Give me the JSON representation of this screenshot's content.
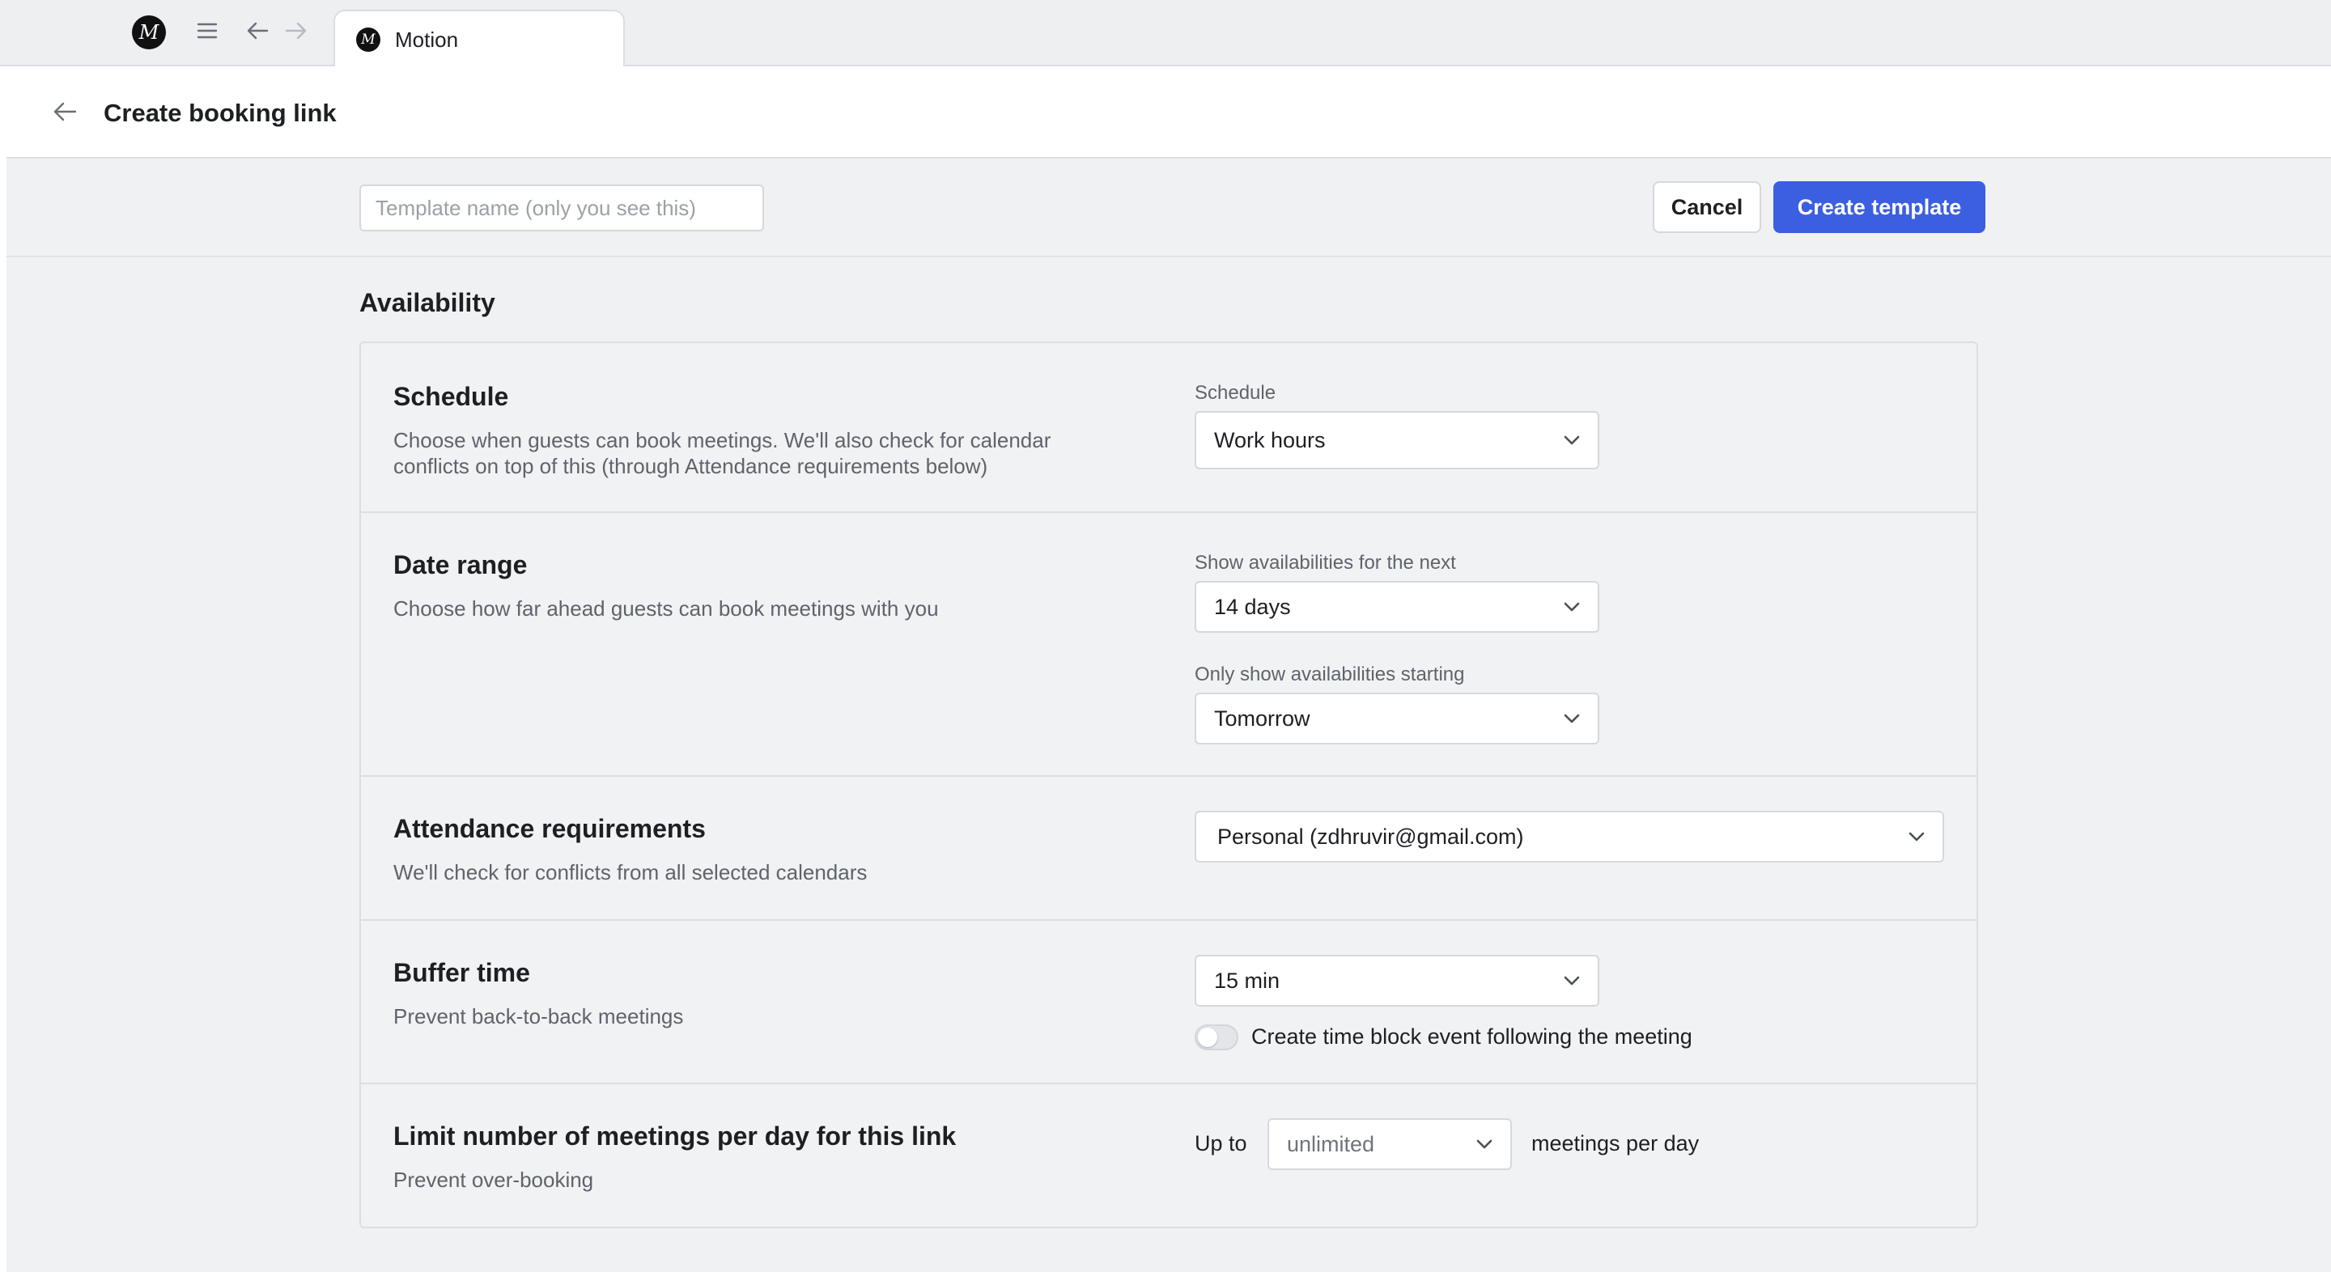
{
  "browser": {
    "logo_letter": "M",
    "tab": {
      "title": "Motion",
      "logo_letter": "M"
    }
  },
  "header": {
    "title": "Create booking link"
  },
  "toolbar": {
    "template_name_value": "",
    "template_name_placeholder": "Template name (only you see this)",
    "cancel_label": "Cancel",
    "create_label": "Create template"
  },
  "availability": {
    "section_title": "Availability",
    "schedule": {
      "title": "Schedule",
      "description": "Choose when guests can book meetings. We'll also check for calendar conflicts on top of this (through Attendance requirements below)",
      "field_label": "Schedule",
      "value": "Work hours"
    },
    "date_range": {
      "title": "Date range",
      "description": "Choose how far ahead guests can book meetings with you",
      "next_label": "Show availabilities for the next",
      "next_value": "14 days",
      "starting_label": "Only show availabilities starting",
      "starting_value": "Tomorrow"
    },
    "attendance": {
      "title": "Attendance requirements",
      "description": "We'll check for conflicts from all selected calendars",
      "value": "Personal (zdhruvir@gmail.com)"
    },
    "buffer": {
      "title": "Buffer time",
      "description": "Prevent back-to-back meetings",
      "value": "15 min",
      "toggle_label": "Create time block event following the meeting",
      "toggle_on": false
    },
    "limit": {
      "title": "Limit number of meetings per day for this link",
      "description": "Prevent over-booking",
      "prefix": "Up to",
      "value": "unlimited",
      "suffix": "meetings per day"
    }
  },
  "colors": {
    "primary": "#3b5fe0",
    "background": "#f0f1f3",
    "border": "#dcdee2",
    "muted_text": "#5f636b"
  }
}
